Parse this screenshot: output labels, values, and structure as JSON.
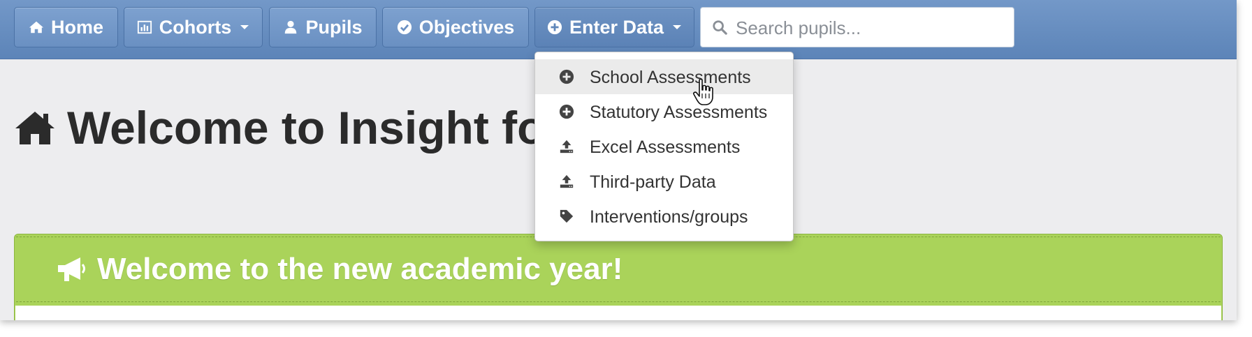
{
  "nav": {
    "items": [
      {
        "label": "Home",
        "icon": "home-icon"
      },
      {
        "label": "Cohorts",
        "icon": "bar-chart-icon",
        "has_caret": true
      },
      {
        "label": "Pupils",
        "icon": "user-icon"
      },
      {
        "label": "Objectives",
        "icon": "check-circle-icon"
      },
      {
        "label": "Enter Data",
        "icon": "plus-circle-icon",
        "has_caret": true,
        "active": true
      }
    ],
    "search": {
      "placeholder": "Search pupils...",
      "value": "",
      "icon": "search-icon"
    }
  },
  "dropdown": {
    "items": [
      {
        "label": "School Assessments",
        "icon": "plus-circle-icon",
        "hovered": true
      },
      {
        "label": "Statutory Assessments",
        "icon": "plus-circle-icon"
      },
      {
        "label": "Excel Assessments",
        "icon": "upload-icon"
      },
      {
        "label": "Third-party Data",
        "icon": "upload-icon"
      },
      {
        "label": "Interventions/groups",
        "icon": "tag-icon"
      }
    ]
  },
  "page": {
    "title": "Welcome to Insight for A",
    "title_icon": "home-icon"
  },
  "alert": {
    "title": "Welcome to the new academic year!",
    "icon": "megaphone-icon"
  },
  "colors": {
    "navbar": "#6a90c2",
    "alert_green": "#aad35a",
    "title_text": "#2b2b2b"
  }
}
